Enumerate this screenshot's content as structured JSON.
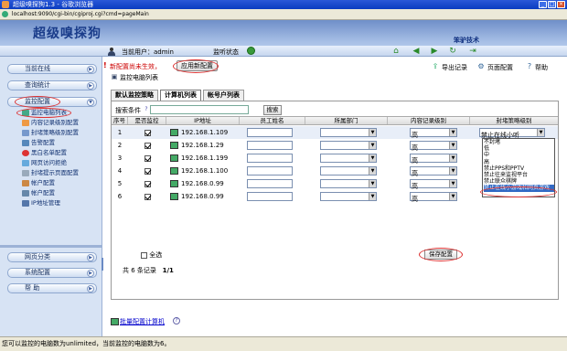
{
  "window": {
    "title": "超级嗅探狗1.3 - 谷歌浏览器"
  },
  "address": {
    "url": "localhost:9090/cgi-bin/cgiproj.cgi?cmd=pageMain"
  },
  "header": {
    "logo": "超级嗅探狗",
    "brand": "笨驴技术"
  },
  "userbar": {
    "current_user": "当前用户：admin",
    "monitor_state": "监听状态"
  },
  "sidebar": {
    "online": "当前在线",
    "query": "查询统计",
    "monitor_config": "监控配置",
    "sub": [
      "监控电脑列表",
      "内容记录级别配置",
      "封堵策略级别配置",
      "告警配置",
      "黑白名单配置",
      "网页访问拒绝",
      "封堵提示页面配置",
      "帐户配置",
      "帐户配置",
      "IP地址管理"
    ],
    "web_category": "网页分类",
    "system_config": "系统配置",
    "help": "帮  助"
  },
  "content": {
    "warning": "新配置尚未生效，",
    "apply_button": "应用新配置",
    "page_title": "监控电脑列表",
    "export": "导出记录",
    "page_config": "页面配置",
    "help": "帮助",
    "tabs": [
      "默认监控策略",
      "计算机列表",
      "帐号户列表"
    ],
    "search_label": "搜索条件",
    "search_button": "搜索",
    "columns": [
      "序号",
      "是否监控",
      "IP地址",
      "员工姓名",
      "所属部门",
      "内容记录级别",
      "封堵策略级别"
    ],
    "rows": [
      {
        "no": "1",
        "monitor": true,
        "ip": "192.168.1.109",
        "name": "",
        "dept": "",
        "level": "高",
        "policy": "禁止在线小听"
      },
      {
        "no": "2",
        "monitor": true,
        "ip": "192.168.1.29",
        "name": "",
        "dept": "",
        "level": "高",
        "policy": ""
      },
      {
        "no": "3",
        "monitor": true,
        "ip": "192.168.1.199",
        "name": "",
        "dept": "",
        "level": "高",
        "policy": ""
      },
      {
        "no": "4",
        "monitor": true,
        "ip": "192.168.1.100",
        "name": "",
        "dept": "",
        "level": "高",
        "policy": ""
      },
      {
        "no": "5",
        "monitor": true,
        "ip": "192.168.0.99",
        "name": "",
        "dept": "",
        "level": "高",
        "policy": ""
      },
      {
        "no": "6",
        "monitor": true,
        "ip": "192.168.0.99",
        "name": "",
        "dept": "",
        "level": "高",
        "policy": ""
      }
    ],
    "policy_options": [
      "不封堵",
      "低",
      "中",
      "高",
      "禁止PPS和PPTV",
      "禁止往来监视平台",
      "禁止联众棋牌",
      "禁止在线小游戏和网页游戏"
    ],
    "select_all": "全选",
    "save_button": "保存配置",
    "total": "共 6 条记录",
    "pages": "1/1",
    "batch_link": "批量配置计算机"
  },
  "status": {
    "text": "您可以监控的电脑数为unlimited，当前监控的电脑数为6。"
  }
}
